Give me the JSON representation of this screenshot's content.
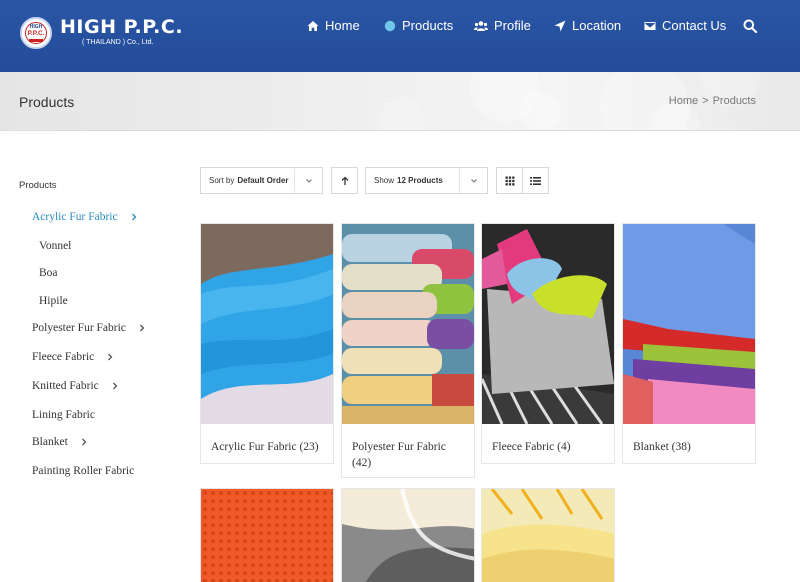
{
  "header": {
    "logo_top": "HIGH",
    "logo_mark": "P.P.C.",
    "logo_name": "HIGH P.P.C.",
    "logo_sub": "( THAILAND ) Co., Ltd.",
    "nav": [
      {
        "label": "Home",
        "icon": "home-icon"
      },
      {
        "label": "Products",
        "icon": "globe-icon",
        "active": true
      },
      {
        "label": "Profile",
        "icon": "users-icon"
      },
      {
        "label": "Location",
        "icon": "location-arrow-icon"
      },
      {
        "label": "Contact Us",
        "icon": "envelope-icon"
      }
    ],
    "search_icon": "search-icon",
    "accent": "#234c98"
  },
  "titlebar": {
    "title": "Products",
    "breadcrumb": [
      "Home",
      "Products"
    ],
    "separator": ">"
  },
  "sidebar": {
    "heading": "Products",
    "items": [
      {
        "label": "Acrylic Fur Fabric",
        "active": true,
        "has_children": true
      },
      {
        "label": "Vonnel",
        "child": true
      },
      {
        "label": "Boa",
        "child": true
      },
      {
        "label": "Hipile",
        "child": true
      },
      {
        "label": "Polyester Fur Fabric",
        "has_children": true
      },
      {
        "label": "Fleece Fabric",
        "has_children": true
      },
      {
        "label": "Knitted Fabric",
        "has_children": true
      },
      {
        "label": "Lining Fabric"
      },
      {
        "label": "Blanket",
        "has_children": true
      },
      {
        "label": "Painting Roller Fabric"
      }
    ],
    "active_color": "#2a8cc4"
  },
  "toolbar": {
    "sort_prefix": "Sort by",
    "sort_value": "Default Order",
    "show_prefix": "Show",
    "show_value": "12 Products"
  },
  "products": [
    {
      "caption": "Acrylic Fur Fabric (23)"
    },
    {
      "caption": "Polyester Fur Fabric (42)"
    },
    {
      "caption": "Fleece Fabric (4)"
    },
    {
      "caption": "Blanket (38)"
    }
  ]
}
